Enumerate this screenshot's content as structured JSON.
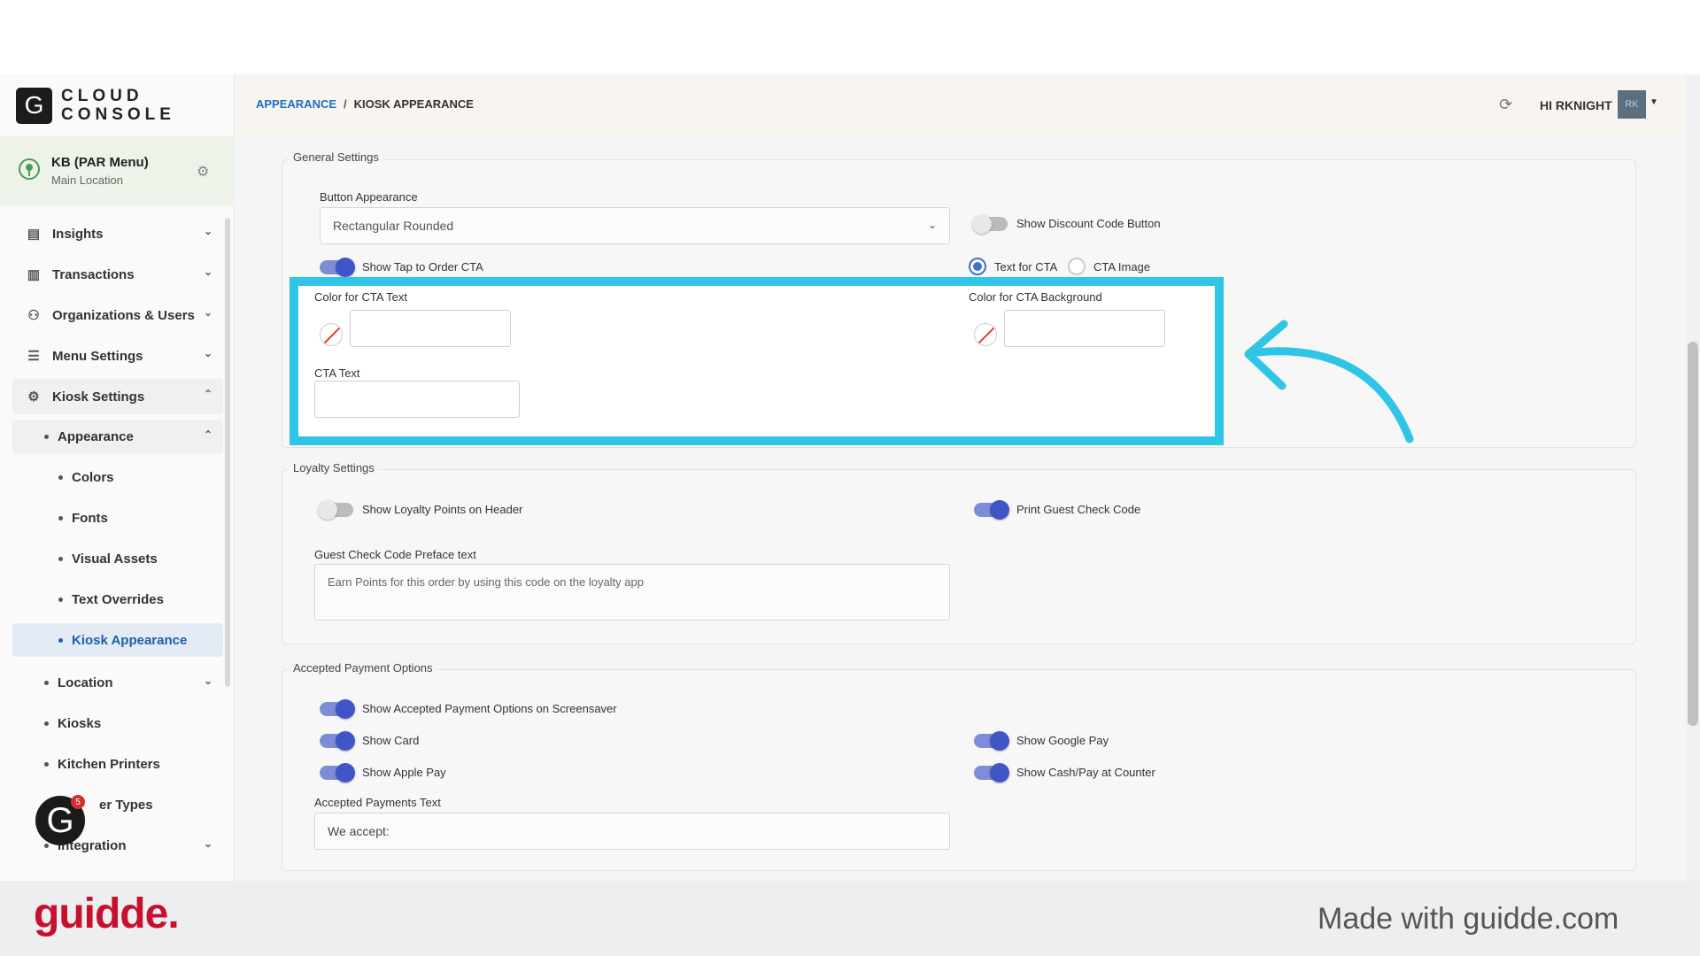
{
  "logo": {
    "letter": "G",
    "line1": "CLOUD",
    "line2": "CONSOLE"
  },
  "location": {
    "name": "KB (PAR Menu)",
    "sub": "Main Location"
  },
  "nav": {
    "insights": "Insights",
    "transactions": "Transactions",
    "orgs": "Organizations & Users",
    "menu_settings": "Menu Settings",
    "kiosk_settings": "Kiosk Settings",
    "appearance": "Appearance",
    "colors": "Colors",
    "fonts": "Fonts",
    "visual_assets": "Visual Assets",
    "text_overrides": "Text Overrides",
    "kiosk_appearance": "Kiosk Appearance",
    "location": "Location",
    "kiosks": "Kiosks",
    "kitchen_printers": "Kitchen Printers",
    "order_types": "er Types",
    "integration": "Integration"
  },
  "badge": {
    "letter": "G",
    "count": "5"
  },
  "breadcrumb": {
    "parent": "APPEARANCE",
    "sep": "/",
    "current": "KIOSK APPEARANCE"
  },
  "user": {
    "greeting": "HI RKNIGHT",
    "initials": "RK"
  },
  "general": {
    "title": "General Settings",
    "button_appearance_label": "Button Appearance",
    "button_appearance_value": "Rectangular Rounded",
    "show_discount": "Show Discount Code Button",
    "show_tap": "Show Tap to Order CTA",
    "text_for_cta": "Text for CTA",
    "cta_image": "CTA Image",
    "color_cta_text": "Color for CTA Text",
    "color_cta_bg": "Color for CTA Background",
    "cta_text": "CTA Text"
  },
  "loyalty": {
    "title": "Loyalty Settings",
    "show_points": "Show Loyalty Points on Header",
    "print_code": "Print Guest Check Code",
    "preface_label": "Guest Check Code Preface text",
    "preface_value": "Earn Points for this order by using this code on the loyalty app"
  },
  "payment": {
    "title": "Accepted Payment Options",
    "show_screensaver": "Show Accepted Payment Options on Screensaver",
    "show_card": "Show Card",
    "show_google": "Show Google Pay",
    "show_apple": "Show Apple Pay",
    "show_cash": "Show Cash/Pay at Counter",
    "text_label": "Accepted Payments Text",
    "text_value": "We accept:"
  },
  "footer": {
    "brand": "guidde.",
    "made": "Made with guidde.com"
  },
  "colors": {
    "highlight": "#2ec5e6",
    "toggle_on": "#3f55c8",
    "brand": "#c8102e"
  }
}
